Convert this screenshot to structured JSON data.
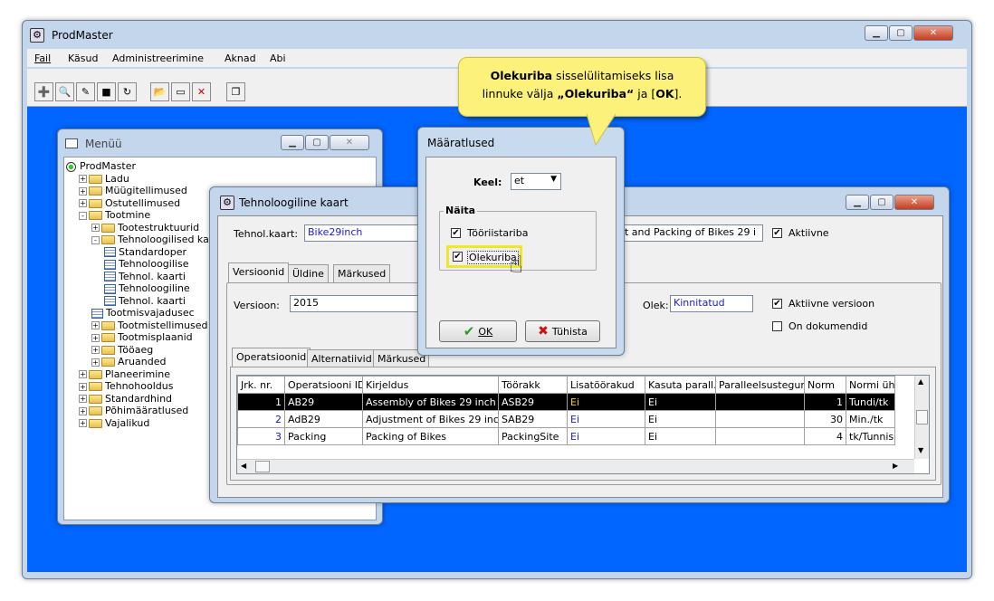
{
  "app": {
    "title": "ProdMaster"
  },
  "menubar": [
    "Fail",
    "Käsud",
    "Administreerimine",
    "Aknad",
    "Abi"
  ],
  "callout": {
    "bold1": "Olekuriba",
    "t1": " sisselülitamiseks lisa",
    "t2": "linnuke välja ",
    "bold2": "„Olekuriba“",
    "t3": " ja [",
    "bold3": "OK",
    "t4": "]."
  },
  "menu_window": {
    "title": "Menüü",
    "tree": [
      {
        "label": "ProdMaster",
        "level": 0,
        "icon": "root-icon"
      },
      {
        "label": "Ladu",
        "level": 1,
        "icon": "folder-icon",
        "pm": "+"
      },
      {
        "label": "Müügitellimused",
        "level": 1,
        "icon": "folder-icon",
        "pm": "+"
      },
      {
        "label": "Ostutellimused",
        "level": 1,
        "icon": "folder-icon",
        "pm": "+"
      },
      {
        "label": "Tootmine",
        "level": 1,
        "icon": "folder-icon",
        "pm": "-"
      },
      {
        "label": "Tootestruktuurid",
        "level": 2,
        "icon": "folder-icon",
        "pm": "+"
      },
      {
        "label": "Tehnoloogilised ka",
        "level": 2,
        "icon": "folder-icon",
        "pm": "-"
      },
      {
        "label": "Standardoper",
        "level": 3,
        "icon": "grid-icon"
      },
      {
        "label": "Tehnoloogilise",
        "level": 3,
        "icon": "grid-icon"
      },
      {
        "label": "Tehnol. kaarti",
        "level": 3,
        "icon": "grid-icon"
      },
      {
        "label": "Tehnoloogiline",
        "level": 3,
        "icon": "grid-icon"
      },
      {
        "label": "Tehnol. kaarti",
        "level": 3,
        "icon": "grid-icon"
      },
      {
        "label": "Tootmisvajadusec",
        "level": 2,
        "icon": "grid-icon"
      },
      {
        "label": "Tootmistellimused",
        "level": 2,
        "icon": "folder-icon",
        "pm": "+"
      },
      {
        "label": "Tootmisplaanid",
        "level": 2,
        "icon": "folder-icon",
        "pm": "+"
      },
      {
        "label": "Tööaeg",
        "level": 2,
        "icon": "folder-icon",
        "pm": "+"
      },
      {
        "label": "Aruanded",
        "level": 2,
        "icon": "folder-icon",
        "pm": "+"
      },
      {
        "label": "Planeerimine",
        "level": 1,
        "icon": "folder-icon",
        "pm": "+"
      },
      {
        "label": "Tehnohooldus",
        "level": 1,
        "icon": "folder-icon",
        "pm": "+"
      },
      {
        "label": "Standardhind",
        "level": 1,
        "icon": "folder-icon",
        "pm": "+"
      },
      {
        "label": "Põhimääratlused",
        "level": 1,
        "icon": "folder-icon",
        "pm": "+"
      },
      {
        "label": "Vajalikud",
        "level": 1,
        "icon": "folder-icon",
        "pm": "+"
      }
    ]
  },
  "tech_window": {
    "title": "Tehnoloogiline kaart",
    "card_label": "Tehnol.kaart:",
    "card_value": "Bike29inch",
    "desc_value": "nt and Packing of Bikes 29 i",
    "active_label": "Aktiivne",
    "tabs": [
      "Versioonid",
      "Üldine",
      "Märkused"
    ],
    "version_label": "Versioon:",
    "version_value": "2015",
    "status_label": "Olek:",
    "status_value": "Kinnitatud",
    "active_version_label": "Aktiivne versioon",
    "documents_label": "On dokumendid",
    "subtabs": [
      "Operatsioonid",
      "Alternatiivid",
      "Märkused"
    ],
    "columns": [
      "Jrk. nr.",
      "Operatsiooni ID",
      "Kirjeldus",
      "Töörakk",
      "Lisatöörakud",
      "Kasuta parall.",
      "Paralleelsustegur",
      "Norm",
      "Normi ühik"
    ],
    "rows": [
      [
        "1",
        "AB29",
        "Assembly of Bikes 29 inch",
        "ASB29",
        "Ei",
        "Ei",
        "",
        "1",
        "Tundi/tk"
      ],
      [
        "2",
        "AdB29",
        "Adjustment of Bikes 29 inch",
        "SAB29",
        "Ei",
        "Ei",
        "",
        "30",
        "Min./tk"
      ],
      [
        "3",
        "Packing",
        "Packing of Bikes",
        "PackingSite",
        "Ei",
        "Ei",
        "",
        "4",
        "tk/Tunnis"
      ]
    ]
  },
  "dialog": {
    "title": "Määratlused",
    "lang_label": "Keel:",
    "lang_value": "et",
    "group_label": "Näita",
    "opt1": "Tööriistariba",
    "opt2": "Olekuriba",
    "ok_label": "OK",
    "cancel_label": "Tühista"
  },
  "colors": {
    "desktop": "#0066ff",
    "selection": "#000000",
    "link": "#1a1ad6"
  }
}
